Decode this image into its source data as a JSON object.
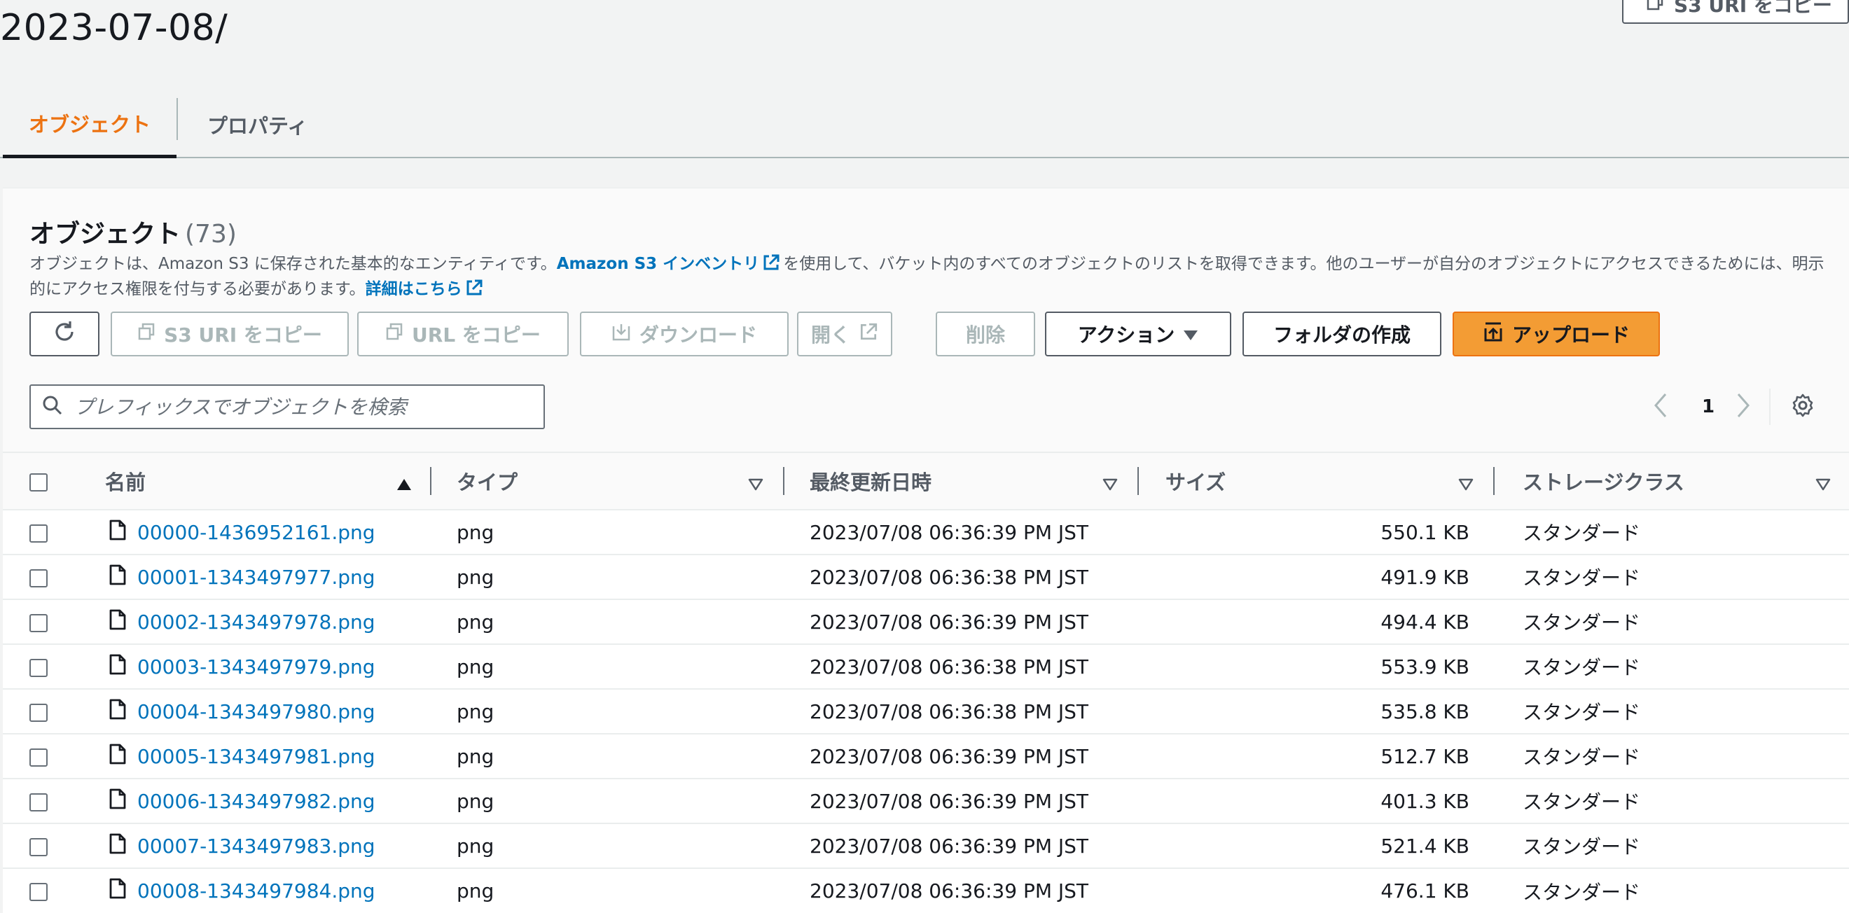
{
  "page": {
    "title": "2023-07-08/",
    "top_copy_button": "S3 URI をコピー"
  },
  "tabs": [
    {
      "label": "オブジェクト",
      "active": true
    },
    {
      "label": "プロパティ",
      "active": false
    }
  ],
  "objects": {
    "heading": "オブジェクト",
    "count": "(73)",
    "description": {
      "part1": "オブジェクトは、Amazon S3 に保存された基本的なエンティティです。",
      "inventory_link": "Amazon S3 インベントリ",
      "part2": "を使用して、バケット内のすべてのオブジェクトのリストを取得できます。他のユーザーが自分のオブジェクトにアクセスできるためには、明示的にアクセス権限を付与する必要があります。",
      "details_link": "詳細はこちら"
    }
  },
  "toolbar": {
    "copy_s3_uri": "S3 URI をコピー",
    "copy_url": "URL をコピー",
    "download": "ダウンロード",
    "open": "開く",
    "delete": "削除",
    "actions": "アクション",
    "create_folder": "フォルダの作成",
    "upload": "アップロード"
  },
  "search": {
    "placeholder": "プレフィックスでオブジェクトを検索",
    "value": ""
  },
  "pagination": {
    "current_page": "1"
  },
  "table": {
    "columns": [
      "名前",
      "タイプ",
      "最終更新日時",
      "サイズ",
      "ストレージクラス"
    ],
    "rows": [
      {
        "name": "00000-1436952161.png",
        "type": "png",
        "modified": "2023/07/08 06:36:39 PM JST",
        "size": "550.1 KB",
        "storage": "スタンダード"
      },
      {
        "name": "00001-1343497977.png",
        "type": "png",
        "modified": "2023/07/08 06:36:38 PM JST",
        "size": "491.9 KB",
        "storage": "スタンダード"
      },
      {
        "name": "00002-1343497978.png",
        "type": "png",
        "modified": "2023/07/08 06:36:39 PM JST",
        "size": "494.4 KB",
        "storage": "スタンダード"
      },
      {
        "name": "00003-1343497979.png",
        "type": "png",
        "modified": "2023/07/08 06:36:38 PM JST",
        "size": "553.9 KB",
        "storage": "スタンダード"
      },
      {
        "name": "00004-1343497980.png",
        "type": "png",
        "modified": "2023/07/08 06:36:38 PM JST",
        "size": "535.8 KB",
        "storage": "スタンダード"
      },
      {
        "name": "00005-1343497981.png",
        "type": "png",
        "modified": "2023/07/08 06:36:39 PM JST",
        "size": "512.7 KB",
        "storage": "スタンダード"
      },
      {
        "name": "00006-1343497982.png",
        "type": "png",
        "modified": "2023/07/08 06:36:39 PM JST",
        "size": "401.3 KB",
        "storage": "スタンダード"
      },
      {
        "name": "00007-1343497983.png",
        "type": "png",
        "modified": "2023/07/08 06:36:39 PM JST",
        "size": "521.4 KB",
        "storage": "スタンダード"
      },
      {
        "name": "00008-1343497984.png",
        "type": "png",
        "modified": "2023/07/08 06:36:39 PM JST",
        "size": "476.1 KB",
        "storage": "スタンダード"
      }
    ]
  },
  "colors": {
    "accent": "#ec7211",
    "link": "#0073bb",
    "primary_button": "#f39c34",
    "text": "#16191f",
    "muted": "#545b64"
  },
  "icons": {
    "refresh": "refresh-icon",
    "copy": "copy-icon",
    "download": "download-icon",
    "external": "external-link-icon",
    "caret": "caret-down-icon",
    "upload": "upload-icon",
    "search": "search-icon",
    "settings": "gear-icon",
    "file": "file-icon"
  }
}
